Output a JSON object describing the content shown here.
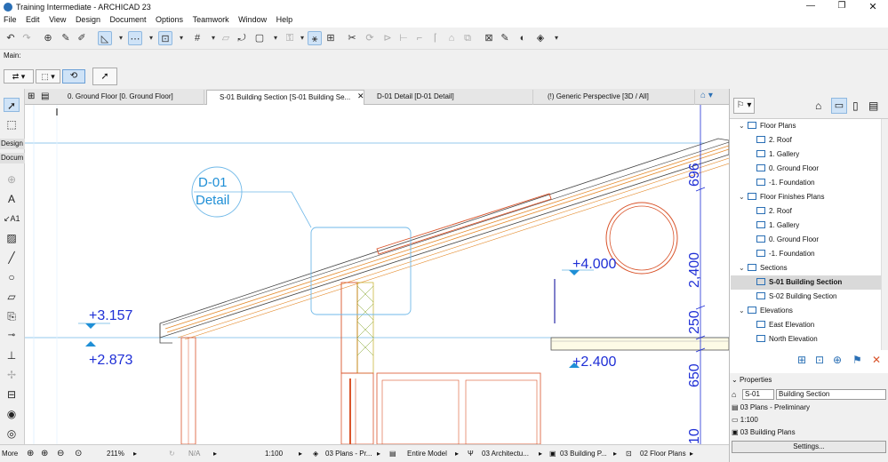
{
  "window": {
    "title": "Training Intermediate - ARCHICAD 23"
  },
  "menu": [
    "File",
    "Edit",
    "View",
    "Design",
    "Document",
    "Options",
    "Teamwork",
    "Window",
    "Help"
  ],
  "toolbar": {
    "main_label": "Main:"
  },
  "toolbox": {
    "design_label": "Design",
    "document_label": "Docum"
  },
  "tabs": [
    {
      "label": "0. Ground Floor [0. Ground Floor]"
    },
    {
      "label": "S-01 Building Section [S-01 Building Se..."
    },
    {
      "label": "D-01 Detail [D-01 Detail]"
    },
    {
      "label": "(!) Generic Perspective [3D / All]"
    }
  ],
  "canvas": {
    "marker_line1": "D-01",
    "marker_line2": "Detail",
    "elevations": [
      "+3.157",
      "+2.873",
      "+4.000",
      "+2.400"
    ],
    "dimensions": [
      "696",
      "2,400",
      "250",
      "650",
      "10"
    ]
  },
  "status": {
    "more": "More",
    "zoom": "211%",
    "angle": "N/A",
    "scale": "1:100",
    "layer_combo": "03 Plans - Pr...",
    "model_view": "Entire Model",
    "arch": "03 Architectu...",
    "building": "03 Building P...",
    "floor_plans": "02 Floor Plans"
  },
  "navigator": {
    "groups": [
      {
        "label": "Floor Plans",
        "items": [
          "2. Roof",
          "1. Gallery",
          "0. Ground Floor",
          "-1. Foundation"
        ]
      },
      {
        "label": "Floor Finishes Plans",
        "items": [
          "2. Roof",
          "1. Gallery",
          "0. Ground Floor",
          "-1. Foundation"
        ]
      },
      {
        "label": "Sections",
        "items": [
          "S-01 Building Section",
          "S-02 Building Section"
        ]
      },
      {
        "label": "Elevations",
        "items": [
          "East Elevation",
          "North Elevation"
        ]
      }
    ],
    "selected": "S-01 Building Section"
  },
  "properties": {
    "header": "Properties",
    "id": "S-01",
    "name": "Building Section",
    "layer": "03 Plans - Preliminary",
    "scale": "1:100",
    "pen_set": "03 Building Plans",
    "settings_button": "Settings..."
  },
  "colors": {
    "accent": "#2a6fb5",
    "dim_blue": "#1f2fd6",
    "wall_red": "#d9542b",
    "selection_blue": "#cfe3f7"
  }
}
